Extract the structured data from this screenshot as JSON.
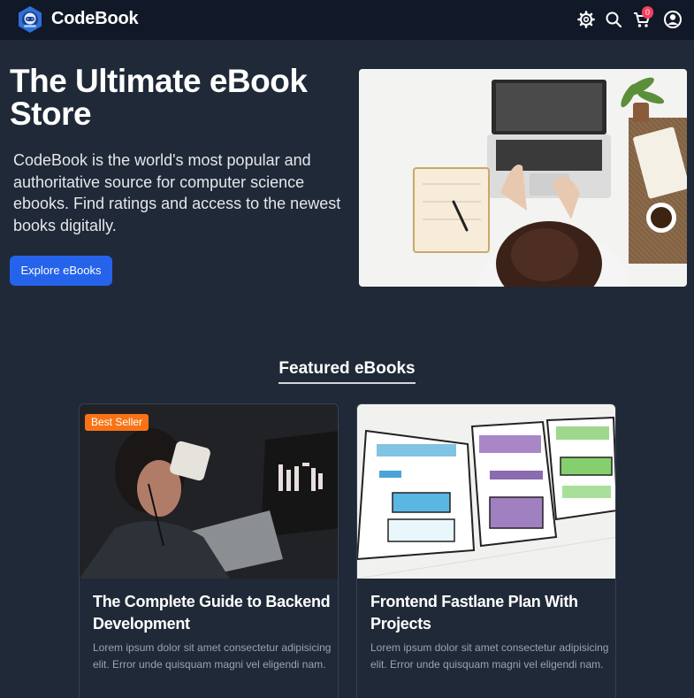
{
  "header": {
    "brand": "CodeBook",
    "icons": [
      "logo-icon",
      "settings-icon",
      "search-icon",
      "cart-icon",
      "user-icon"
    ],
    "cart_count": "0"
  },
  "hero": {
    "title": "The Ultimate eBook Store",
    "description": "CodeBook is the world's most popular and authoritative source for computer science ebooks. Find ratings and access to the newest books digitally.",
    "button_label": "Explore eBooks"
  },
  "featured": {
    "title": "Featured eBooks",
    "cards": [
      {
        "badge": "Best Seller",
        "title": "The Complete Guide to Backend Development",
        "description": "Lorem ipsum dolor sit amet consectetur adipisicing elit. Error unde quisquam magni vel eligendi nam."
      },
      {
        "title": "Frontend Fastlane Plan With Projects",
        "description": "Lorem ipsum dolor sit amet consectetur adipisicing elit. Error unde quisquam magni vel eligendi nam."
      }
    ]
  },
  "colors": {
    "background": "#1f2937",
    "header": "#111827",
    "accent": "#2563eb",
    "badge": "#f97316",
    "cart_badge": "#f43f5e"
  }
}
